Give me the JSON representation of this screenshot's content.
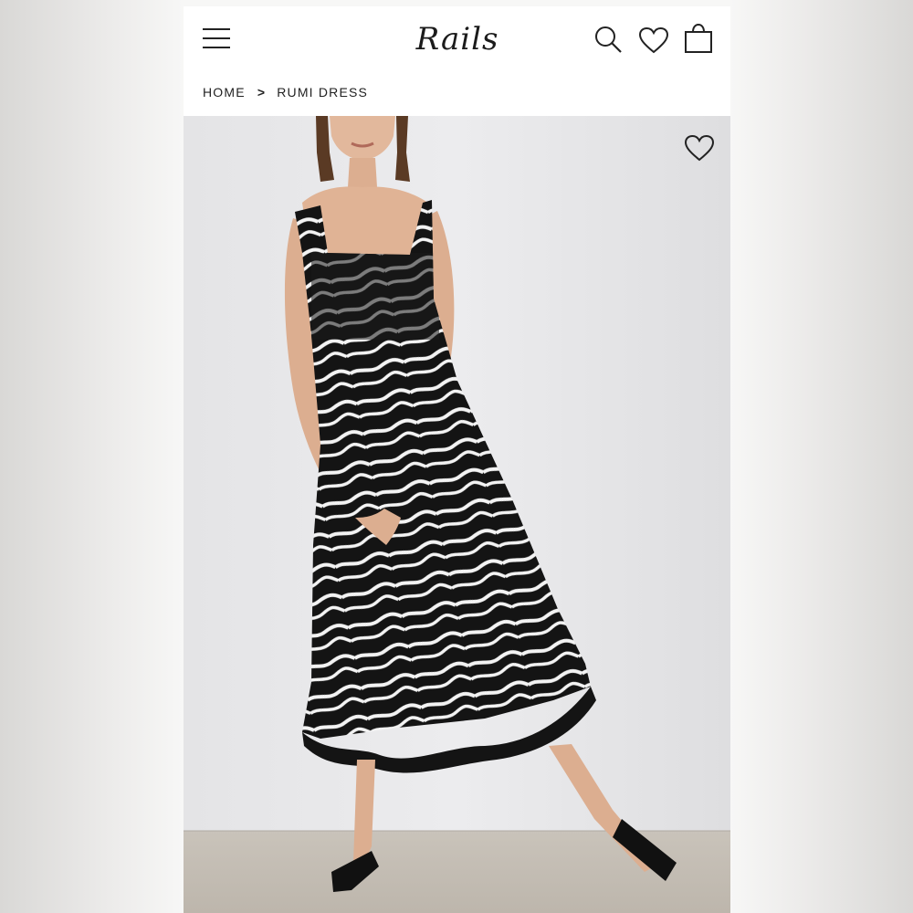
{
  "brand": {
    "logo_text": "Rails"
  },
  "header": {
    "icons": [
      "menu-icon",
      "search-icon",
      "heart-icon",
      "shopping-bag-icon"
    ]
  },
  "breadcrumb": {
    "home": "HOME",
    "separator": ">",
    "current": "RUMI DRESS"
  },
  "product": {
    "image_alt": "Model wearing black and white zebra print smocked midi dress with ruffle hem",
    "wishlist_icon": "heart-outline-icon"
  },
  "colors": {
    "text": "#222222",
    "page_background": "#ffffff",
    "photo_background": "#e6e6e8",
    "dress_black": "#141414",
    "dress_white": "#f3f3f3"
  }
}
